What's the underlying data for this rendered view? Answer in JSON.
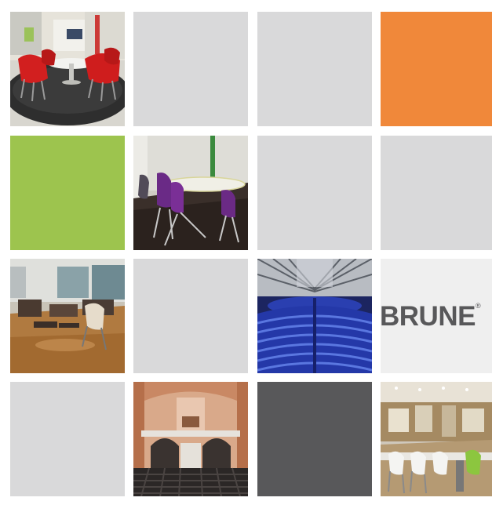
{
  "brand": {
    "logo_text": "BRUNE",
    "logo_mark": "®"
  },
  "colors": {
    "light_gray": "#d9d9da",
    "orange": "#f0883a",
    "green": "#9dc44e",
    "dark_gray": "#58585a",
    "logo_bg": "#efefef"
  },
  "tiles": [
    {
      "row": 1,
      "col": 1,
      "kind": "photo",
      "subject": "lounge-red-chairs"
    },
    {
      "row": 1,
      "col": 2,
      "kind": "solid",
      "color": "light_gray"
    },
    {
      "row": 1,
      "col": 3,
      "kind": "solid",
      "color": "light_gray"
    },
    {
      "row": 1,
      "col": 4,
      "kind": "solid",
      "color": "orange"
    },
    {
      "row": 2,
      "col": 1,
      "kind": "solid",
      "color": "green"
    },
    {
      "row": 2,
      "col": 2,
      "kind": "photo",
      "subject": "meeting-room-purple-chairs"
    },
    {
      "row": 2,
      "col": 3,
      "kind": "solid",
      "color": "light_gray"
    },
    {
      "row": 2,
      "col": 4,
      "kind": "solid",
      "color": "light_gray"
    },
    {
      "row": 3,
      "col": 1,
      "kind": "photo",
      "subject": "cafeteria-wood-floor"
    },
    {
      "row": 3,
      "col": 2,
      "kind": "solid",
      "color": "light_gray"
    },
    {
      "row": 3,
      "col": 3,
      "kind": "photo",
      "subject": "auditorium-blue-seats"
    },
    {
      "row": 3,
      "col": 4,
      "kind": "logo"
    },
    {
      "row": 4,
      "col": 1,
      "kind": "solid",
      "color": "light_gray"
    },
    {
      "row": 4,
      "col": 2,
      "kind": "photo",
      "subject": "church-hall-seating"
    },
    {
      "row": 4,
      "col": 3,
      "kind": "solid",
      "color": "dark_gray"
    },
    {
      "row": 4,
      "col": 4,
      "kind": "photo",
      "subject": "canteen-white-green-chairs"
    }
  ]
}
